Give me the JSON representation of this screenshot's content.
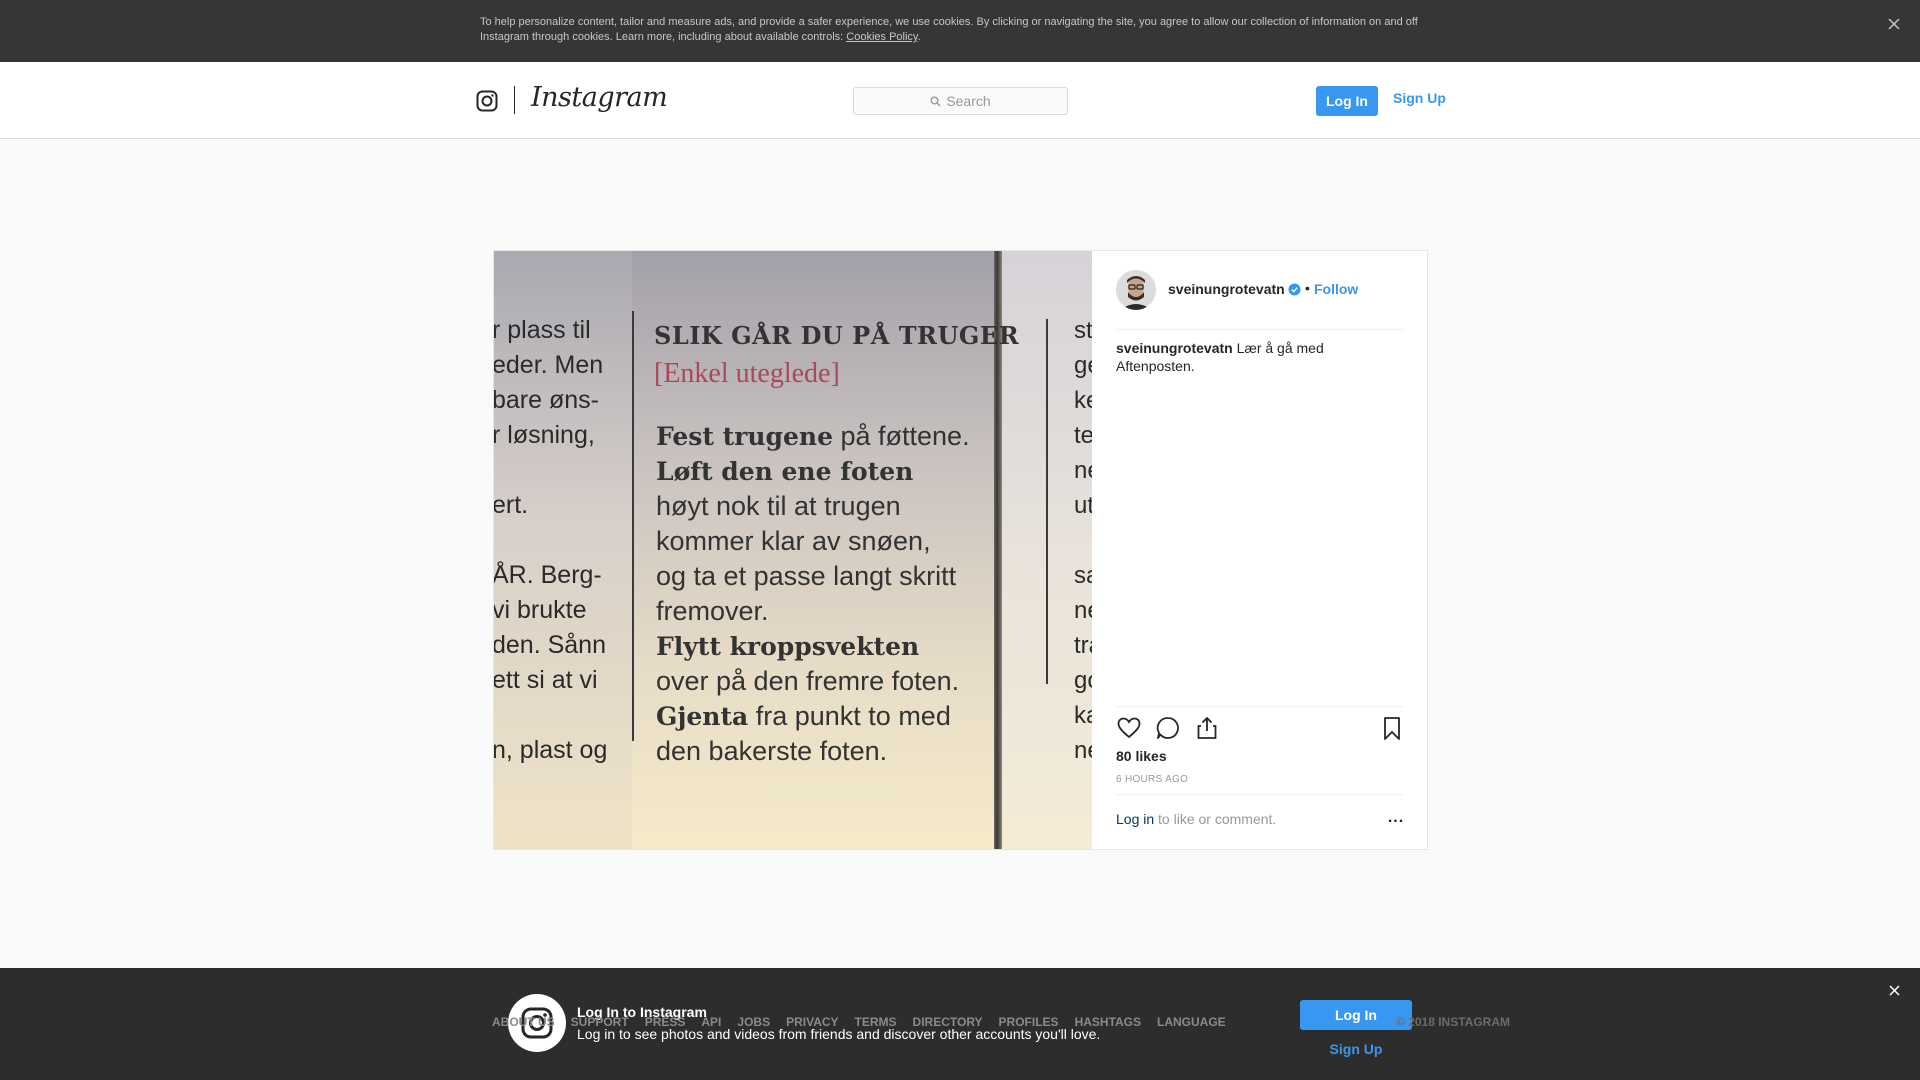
{
  "cookie_banner": {
    "text": "To help personalize content, tailor and measure ads, and provide a safer experience, we use cookies. By clicking or navigating the site, you agree to allow our collection of information on and off Instagram through cookies. Learn more, including about available controls: ",
    "link": "Cookies Policy",
    "suffix": ".",
    "close_icon": "close-icon"
  },
  "nav": {
    "logo_icon": "instagram-camera-icon",
    "wordmark": "Instagram",
    "search_placeholder": "Search",
    "search_icon": "search-icon",
    "login_label": "Log In",
    "signup_label": "Sign Up"
  },
  "post": {
    "photo": {
      "left_column": [
        "r plass til",
        "eder. Men",
        "bare øns-",
        "r løsning,",
        "",
        "ert.",
        "",
        "ÅR. Berg-",
        "vi brukte",
        "den. Sånn",
        "ett si at vi",
        "",
        "n, plast og"
      ],
      "heading": "SLIK GÅR DU PÅ TRUGER",
      "subheading": "[Enkel uteglede]",
      "body": [
        {
          "bold": "Fest trugene",
          "rest": " på føttene."
        },
        {
          "bold": "Løft den ene foten",
          "rest": ""
        },
        {
          "bold": "",
          "rest": "høyt nok til at trugen"
        },
        {
          "bold": "",
          "rest": "kommer klar av snøen,"
        },
        {
          "bold": "",
          "rest": "og ta et passe langt skritt"
        },
        {
          "bold": "",
          "rest": "fremover."
        },
        {
          "bold": "Flytt kroppsvekten",
          "rest": ""
        },
        {
          "bold": "",
          "rest": "over på den fremre foten."
        },
        {
          "bold": "Gjenta",
          "rest": " fra punkt to med"
        },
        {
          "bold": "",
          "rest": "den bakerste foten."
        }
      ],
      "right_column": [
        "st",
        "ge",
        "ke",
        "te",
        "ne",
        "ut",
        "",
        "sa",
        "ne",
        "tra",
        "go",
        "ka",
        "ne"
      ]
    },
    "owner": "sveinungrotevatn",
    "verified_icon": "verified-badge-icon",
    "separator": "•",
    "follow_label": "Follow",
    "caption_user": "sveinungrotevatn",
    "caption_text": " Lær å gå med Aftenposten.",
    "actions": [
      "heart-icon",
      "comment-icon",
      "share-icon",
      "bookmark-icon"
    ],
    "likes": "80 likes",
    "time": "6 HOURS AGO",
    "login_link": "Log in",
    "login_rest": " to like or comment.",
    "more_label": "..."
  },
  "footer": {
    "links": [
      "ABOUT US",
      "SUPPORT",
      "PRESS",
      "API",
      "JOBS",
      "PRIVACY",
      "TERMS",
      "DIRECTORY",
      "PROFILES",
      "HASHTAGS",
      "LANGUAGE"
    ],
    "copyright": "© 2018 INSTAGRAM"
  },
  "bottom_banner": {
    "icon": "instagram-camera-icon",
    "title": "Log In to Instagram",
    "subtitle": "Log in to see photos and videos from friends and discover other accounts you'll love.",
    "login_label": "Log In",
    "signup_label": "Sign Up",
    "close_icon": "close-icon"
  },
  "colors": {
    "accent": "#3897f0",
    "banner_bg": "#363636",
    "page_bg": "#fafafa"
  }
}
